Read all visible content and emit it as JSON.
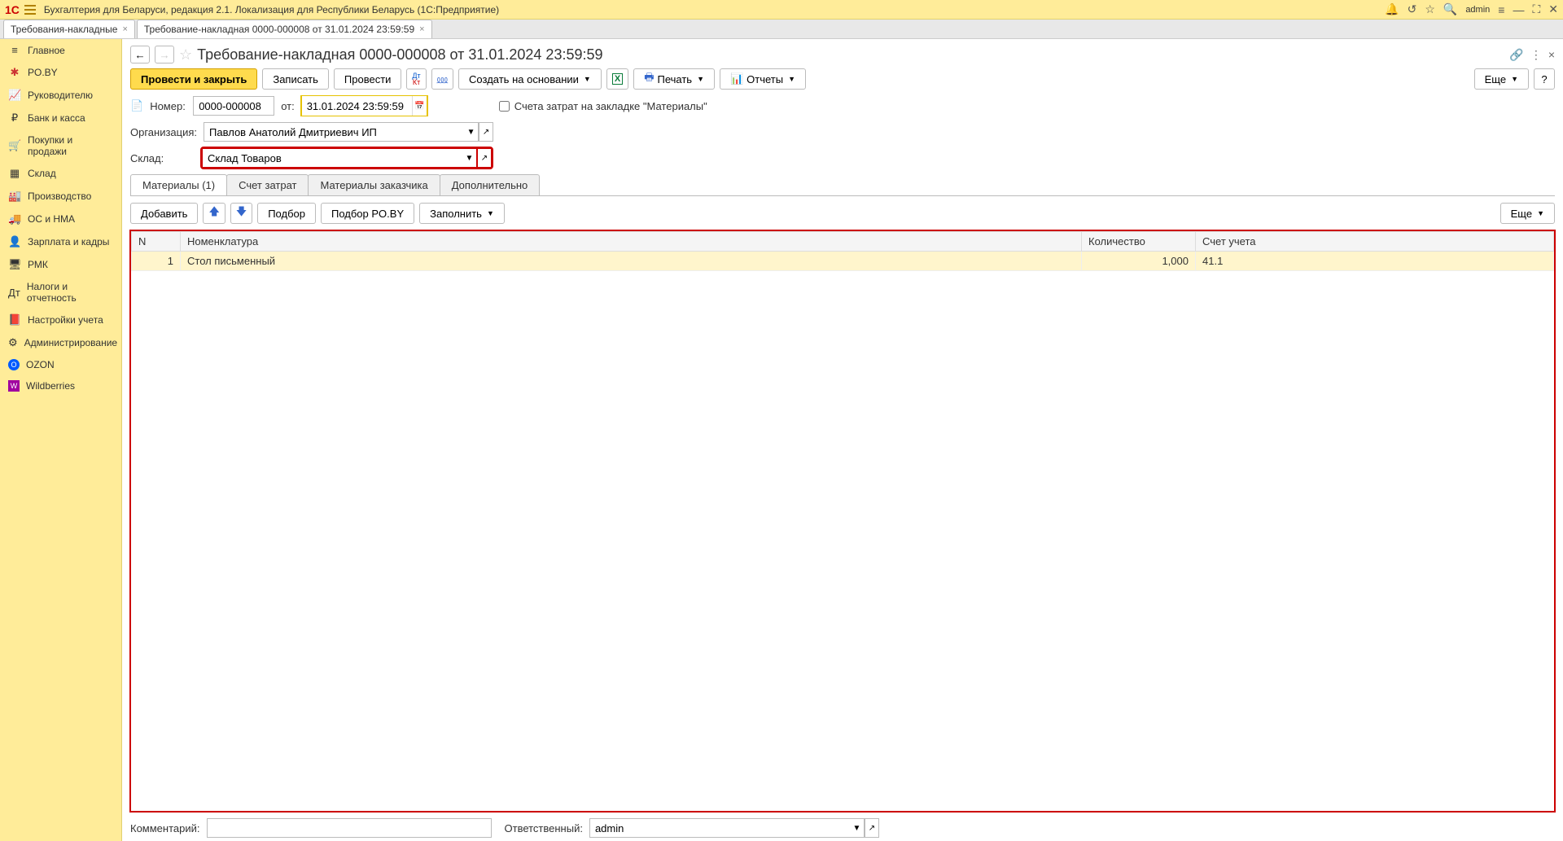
{
  "titlebar": {
    "app_title": "Бухгалтерия для Беларуси, редакция 2.1. Локализация для Республики Беларусь   (1С:Предприятие)",
    "user": "admin"
  },
  "doctabs": [
    {
      "label": "Требования-накладные"
    },
    {
      "label": "Требование-накладная 0000-000008 от 31.01.2024 23:59:59"
    }
  ],
  "sidebar": {
    "items": [
      {
        "label": "Главное"
      },
      {
        "label": "PO.BY"
      },
      {
        "label": "Руководителю"
      },
      {
        "label": "Банк и касса"
      },
      {
        "label": "Покупки и продажи"
      },
      {
        "label": "Склад"
      },
      {
        "label": "Производство"
      },
      {
        "label": "ОС и НМА"
      },
      {
        "label": "Зарплата и кадры"
      },
      {
        "label": "РМК"
      },
      {
        "label": "Налоги и отчетность"
      },
      {
        "label": "Настройки учета"
      },
      {
        "label": "Администрирование"
      },
      {
        "label": "OZON"
      },
      {
        "label": "Wildberries"
      }
    ]
  },
  "page": {
    "title": "Требование-накладная 0000-000008 от 31.01.2024 23:59:59"
  },
  "toolbar": {
    "post_close": "Провести и закрыть",
    "write": "Записать",
    "post": "Провести",
    "create_based": "Создать на основании",
    "print": "Печать",
    "reports": "Отчеты",
    "more": "Еще",
    "help": "?"
  },
  "form": {
    "number_label": "Номер:",
    "number_value": "0000-000008",
    "date_label": "от:",
    "date_value": "31.01.2024 23:59:59",
    "org_label": "Организация:",
    "org_value": "Павлов Анатолий Дмитриевич ИП",
    "warehouse_label": "Склад:",
    "warehouse_value": "Склад Товаров",
    "cost_acc_checkbox": "Счета затрат на закладке \"Материалы\""
  },
  "tabs": {
    "materials": "Материалы (1)",
    "cost": "Счет затрат",
    "customer": "Материалы заказчика",
    "extra": "Дополнительно"
  },
  "table_toolbar": {
    "add": "Добавить",
    "select": "Подбор",
    "select_poby": "Подбор PO.BY",
    "fill": "Заполнить",
    "more": "Еще"
  },
  "table": {
    "headers": {
      "n": "N",
      "nom": "Номенклатура",
      "qty": "Количество",
      "acc": "Счет учета"
    },
    "rows": [
      {
        "n": "1",
        "nom": "Стол письменный",
        "qty": "1,000",
        "acc": "41.1"
      }
    ]
  },
  "footer": {
    "comment_label": "Комментарий:",
    "comment_value": "",
    "responsible_label": "Ответственный:",
    "responsible_value": "admin"
  }
}
